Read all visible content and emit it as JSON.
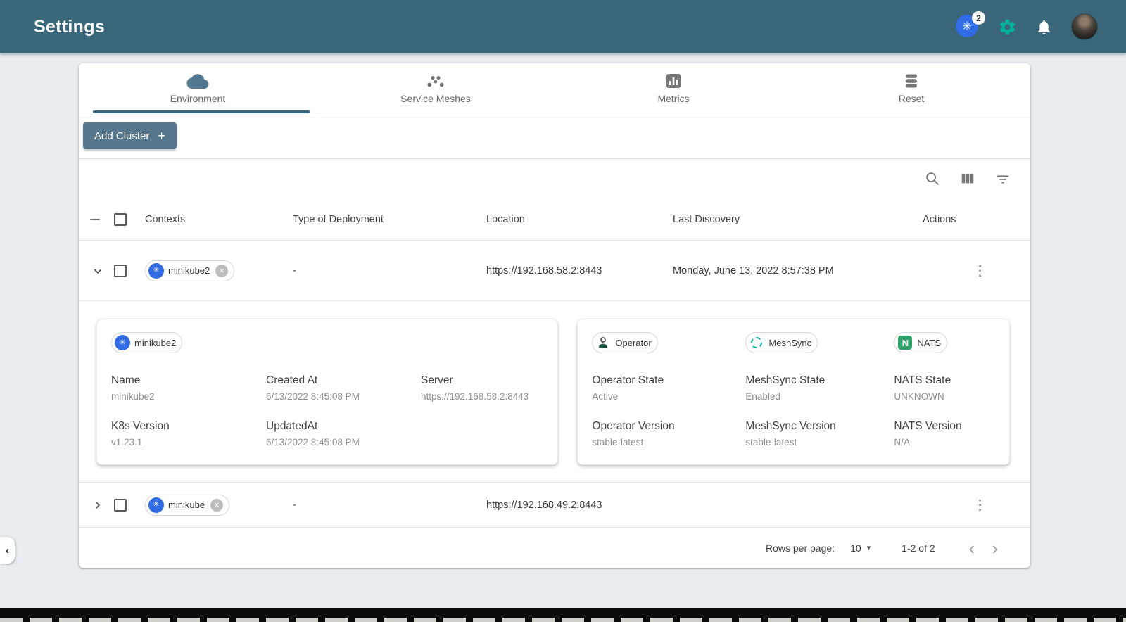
{
  "colors": {
    "header_bg": "#396679",
    "accent_green": "#00B39F",
    "kubernetes_blue": "#326CE5",
    "add_button_bg": "#57788C",
    "active_tab_underline": "#396679",
    "nats_green": "#2FA36B"
  },
  "header": {
    "title": "Settings",
    "k8s_badge_count": "2"
  },
  "tabs": [
    {
      "label": "Environment"
    },
    {
      "label": "Service Meshes"
    },
    {
      "label": "Metrics"
    },
    {
      "label": "Reset"
    }
  ],
  "actions_bar": {
    "add_cluster_label": "Add Cluster",
    "add_cluster_plus": "+"
  },
  "table": {
    "columns": {
      "contexts": "Contexts",
      "type": "Type of Deployment",
      "location": "Location",
      "last_discovery": "Last Discovery",
      "actions": "Actions"
    },
    "rows": [
      {
        "context": "minikube2",
        "type": "-",
        "location": "https://192.168.58.2:8443",
        "last_discovery": "Monday, June 13, 2022 8:57:38 PM"
      },
      {
        "context": "minikube",
        "type": "-",
        "location": "https://192.168.49.2:8443",
        "last_discovery": ""
      }
    ]
  },
  "details": {
    "cluster_chip": "minikube2",
    "left": {
      "fields": [
        {
          "label": "Name",
          "value": "minikube2"
        },
        {
          "label": "Created At",
          "value": "6/13/2022 8:45:08 PM"
        },
        {
          "label": "Server",
          "value": "https://192.168.58.2:8443"
        },
        {
          "label": "K8s Version",
          "value": "v1.23.1"
        },
        {
          "label": "UpdatedAt",
          "value": "6/13/2022 8:45:08 PM"
        }
      ]
    },
    "right": {
      "chips": [
        "Operator",
        "MeshSync",
        "NATS"
      ],
      "fields": [
        {
          "label": "Operator State",
          "value": "Active"
        },
        {
          "label": "MeshSync State",
          "value": "Enabled"
        },
        {
          "label": "NATS State",
          "value": "UNKNOWN"
        },
        {
          "label": "Operator Version",
          "value": "stable-latest"
        },
        {
          "label": "MeshSync Version",
          "value": "stable-latest"
        },
        {
          "label": "NATS Version",
          "value": "N/A"
        }
      ]
    }
  },
  "pagination": {
    "rows_per_page_label": "Rows per page:",
    "rows_per_page_value": "10",
    "range_label": "1-2 of 2"
  },
  "icons": {
    "kebab": "⋮",
    "close": "×",
    "caret": "▾",
    "prev": "‹",
    "next": "›",
    "k8s_glyph": "✳",
    "handle": "‹"
  }
}
